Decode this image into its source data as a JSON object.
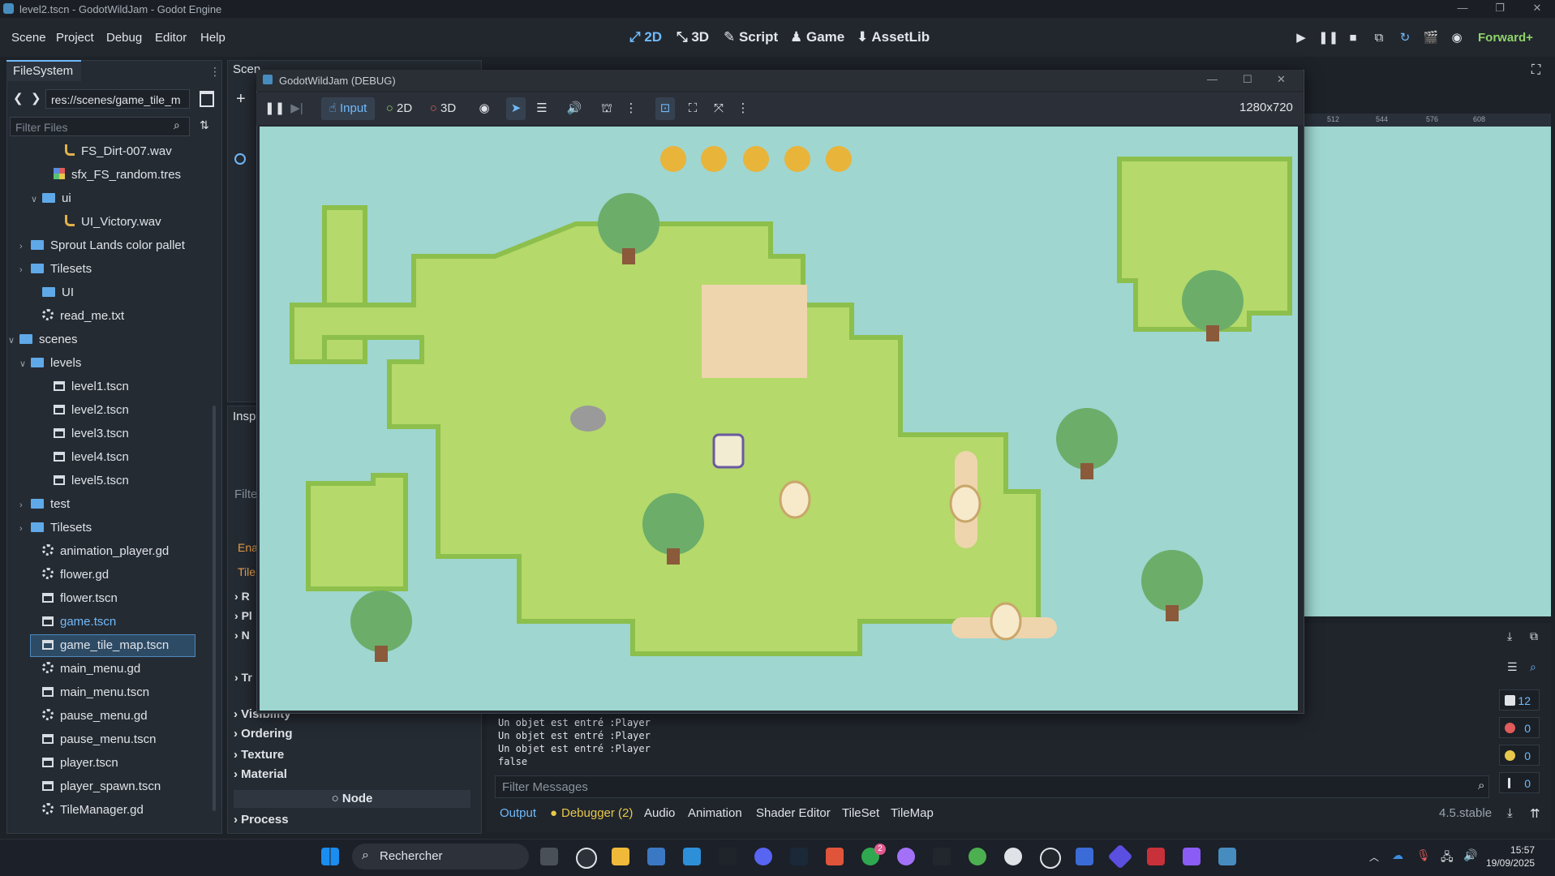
{
  "window": {
    "title": "level2.tscn - GodotWildJam - Godot Engine"
  },
  "menu": [
    "Scene",
    "Project",
    "Debug",
    "Editor",
    "Help"
  ],
  "main_tabs": [
    "2D",
    "3D",
    "Script",
    "Game",
    "AssetLib"
  ],
  "renderer": "Forward+",
  "filesystem": {
    "tab_label": "FileSystem",
    "path": "res://scenes/game_tile_m",
    "filter_placeholder": "Filter Files",
    "items": [
      {
        "label": "FS_Dirt-007.wav",
        "type": "audio"
      },
      {
        "label": "sfx_FS_random.tres",
        "type": "res"
      },
      {
        "label": "ui",
        "type": "folder"
      },
      {
        "label": "UI_Victory.wav",
        "type": "audio"
      },
      {
        "label": "Sprout Lands color pallet",
        "type": "folder"
      },
      {
        "label": "Tilesets",
        "type": "folder"
      },
      {
        "label": "UI",
        "type": "folder"
      },
      {
        "label": "read_me.txt",
        "type": "gear"
      },
      {
        "label": "scenes",
        "type": "folder"
      },
      {
        "label": "levels",
        "type": "folder"
      },
      {
        "label": "level1.tscn",
        "type": "scene"
      },
      {
        "label": "level2.tscn",
        "type": "scene"
      },
      {
        "label": "level3.tscn",
        "type": "scene"
      },
      {
        "label": "level4.tscn",
        "type": "scene"
      },
      {
        "label": "level5.tscn",
        "type": "scene"
      },
      {
        "label": "test",
        "type": "folder"
      },
      {
        "label": "Tilesets",
        "type": "folder"
      },
      {
        "label": "animation_player.gd",
        "type": "gear"
      },
      {
        "label": "flower.gd",
        "type": "gear"
      },
      {
        "label": "flower.tscn",
        "type": "scene"
      },
      {
        "label": "game.tscn",
        "type": "scene"
      },
      {
        "label": "game_tile_map.tscn",
        "type": "scene"
      },
      {
        "label": "main_menu.gd",
        "type": "gear"
      },
      {
        "label": "main_menu.tscn",
        "type": "scene"
      },
      {
        "label": "pause_menu.gd",
        "type": "gear"
      },
      {
        "label": "pause_menu.tscn",
        "type": "scene"
      },
      {
        "label": "player.tscn",
        "type": "scene"
      },
      {
        "label": "player_spawn.tscn",
        "type": "scene"
      },
      {
        "label": "TileManager.gd",
        "type": "gear"
      }
    ]
  },
  "scene_dock": {
    "tab_label": "Scen"
  },
  "inspector": {
    "tab_label": "Insp",
    "filter_placeholder": "Filte",
    "sections": [
      "Visibility",
      "Ordering",
      "Texture",
      "Material"
    ],
    "node_label": "Node",
    "process_label": "Process",
    "partial_labels": [
      "Ena",
      "Tile",
      "R",
      "Pl",
      "N",
      "Tr"
    ]
  },
  "game_window": {
    "title": "GodotWildJam (DEBUG)",
    "input_label": "Input",
    "mode_2d": "2D",
    "mode_3d": "3D",
    "resolution": "1280x720"
  },
  "ruler_ticks": [
    "512",
    "544",
    "576",
    "608"
  ],
  "output": {
    "lines": [
      "Un objet est entré :Player",
      "Un objet est entré :Player",
      "Un objet est entré :Player",
      "false"
    ],
    "filter_placeholder": "Filter Messages",
    "tabs": [
      "Output",
      "Debugger (2)",
      "Audio",
      "Animation",
      "Shader Editor",
      "TileSet",
      "TileMap"
    ],
    "version": "4.5.stable",
    "counters": [
      {
        "value": "12",
        "color": "#dfe3e8"
      },
      {
        "value": "0",
        "color": "#e15b5b"
      },
      {
        "value": "0",
        "color": "#e8c84a"
      },
      {
        "value": "0",
        "color": "#dfe3e8"
      }
    ]
  },
  "taskbar": {
    "search_label": "Rechercher",
    "time": "15:57",
    "date": "19/09/2025",
    "xbox_badge": "2"
  },
  "colors": {
    "accent": "#70bafa",
    "water": "#9fd6d0",
    "grass": "#b5d96a"
  }
}
